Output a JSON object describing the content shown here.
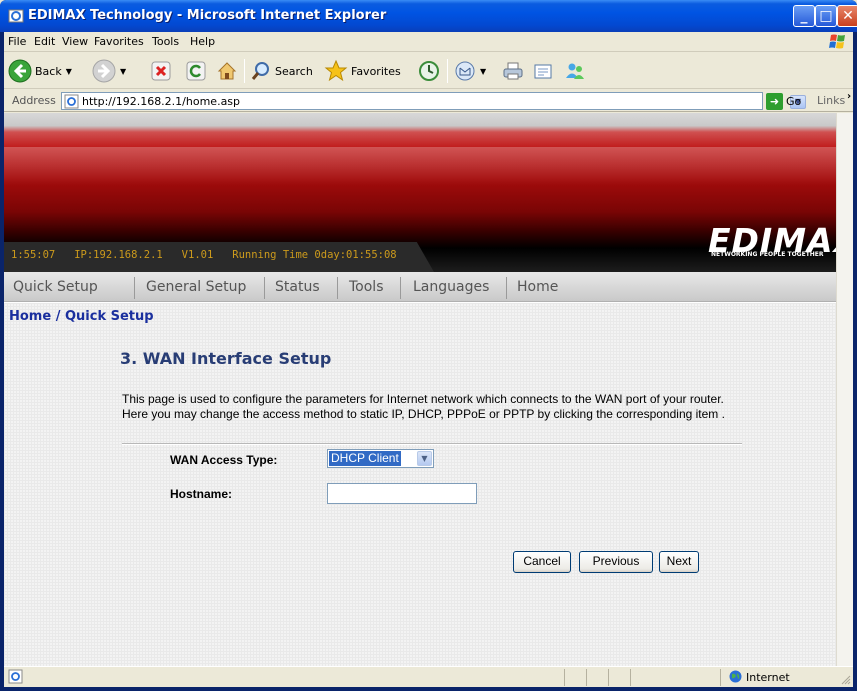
{
  "window": {
    "title": "EDIMAX Technology - Microsoft Internet Explorer"
  },
  "menu": {
    "items": [
      "File",
      "Edit",
      "View",
      "Favorites",
      "Tools",
      "Help"
    ]
  },
  "toolbar": {
    "back_label": "Back",
    "search_label": "Search",
    "favorites_label": "Favorites"
  },
  "address": {
    "label": "Address",
    "url": "http://192.168.2.1/home.asp",
    "go_label": "Go",
    "links_label": "Links"
  },
  "banner": {
    "status_line": "1:55:07   IP:192.168.2.1   V1.01   Running Time 0day:01:55:08",
    "brand": "EDIMAX",
    "tagline": "NETWORKING PEOPLE TOGETHER"
  },
  "nav": {
    "items": [
      "Quick Setup",
      "General Setup",
      "Status",
      "Tools",
      "Languages",
      "Home"
    ]
  },
  "page": {
    "breadcrumb": "Home / Quick Setup",
    "title": "3. WAN Interface Setup",
    "description": "This page is used to configure the parameters for Internet network which connects to the WAN port of your router. Here you may change the access method to static IP, DHCP, PPPoE or PPTP by clicking the corresponding item .",
    "wan_access_type_label": "WAN Access Type:",
    "wan_access_type_value": "DHCP Client",
    "hostname_label": "Hostname:",
    "hostname_value": "",
    "cancel_label": "Cancel",
    "previous_label": "Previous",
    "next_label": "Next"
  },
  "statusbar": {
    "zone": "Internet"
  }
}
